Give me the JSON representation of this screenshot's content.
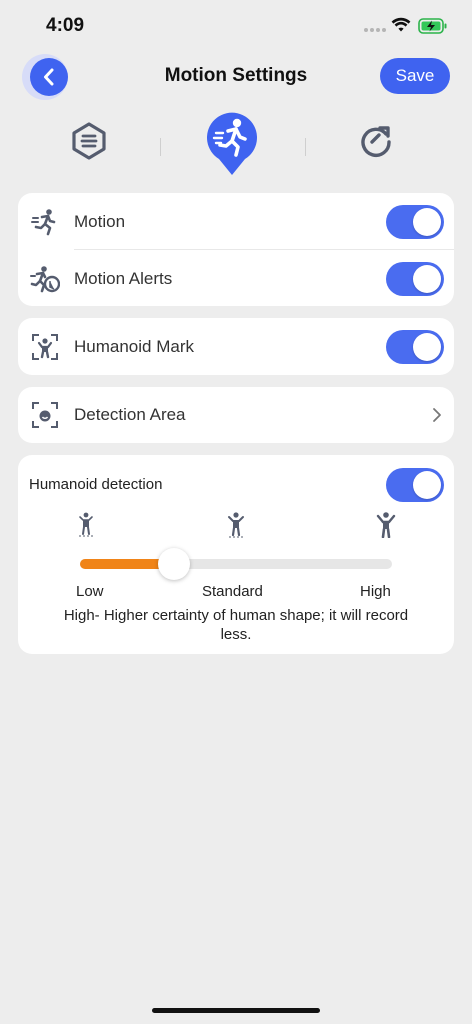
{
  "status_bar": {
    "time": "4:09"
  },
  "header": {
    "title": "Motion Settings",
    "save_label": "Save"
  },
  "mode_tabs": [
    {
      "icon": "list-mode-icon",
      "active": false
    },
    {
      "icon": "running-person-icon",
      "active": true
    },
    {
      "icon": "refresh-arrow-icon",
      "active": false
    }
  ],
  "motion_card": {
    "rows": [
      {
        "label": "Motion",
        "icon": "motion-runner-icon",
        "enabled": true
      },
      {
        "label": "Motion Alerts",
        "icon": "motion-alert-icon",
        "enabled": true
      }
    ]
  },
  "humanoid_mark": {
    "label": "Humanoid Mark",
    "icon": "humanoid-frame-icon",
    "enabled": true
  },
  "detection_area": {
    "label": "Detection Area",
    "icon": "face-frame-icon"
  },
  "humanoid_detection": {
    "title": "Humanoid detection",
    "enabled": true,
    "levels": [
      "Low",
      "Standard",
      "High"
    ],
    "slider_level": 0.3,
    "description": "High- Higher certainty of human shape; it will record less."
  },
  "colors": {
    "accent": "#3f63f0",
    "toggle_on": "#4a6cf0",
    "slider_fill": "#f08418",
    "icon_gray": "#555c6e",
    "background": "#ededed"
  }
}
